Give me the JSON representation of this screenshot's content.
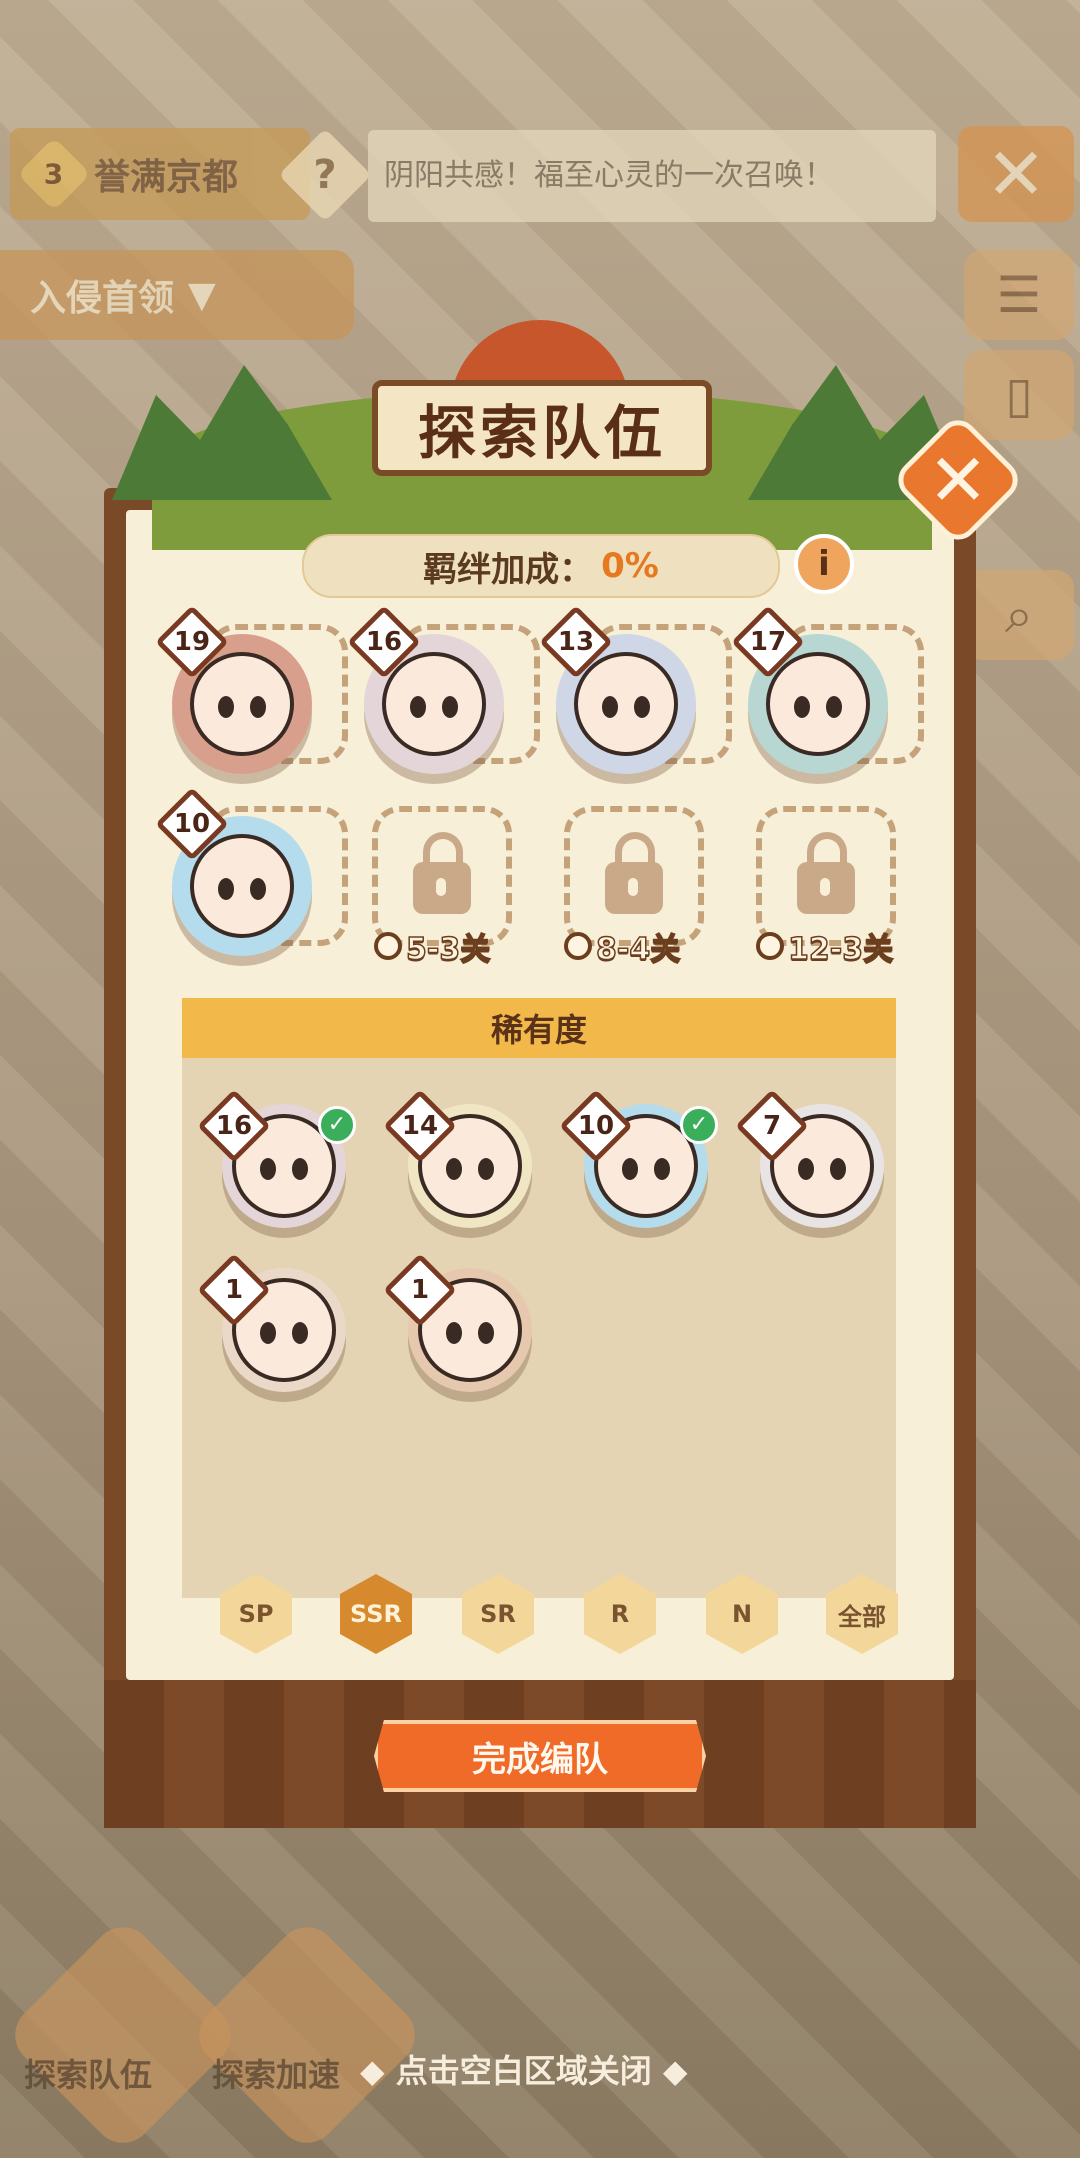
{
  "topbar": {
    "stage_number": "3",
    "stage_name": "誉满京都",
    "help_symbol": "?",
    "marquee": "阴阳共感！福至心灵的一次召唤！",
    "close_symbol": "✕",
    "boss_dropdown": "入侵首领"
  },
  "modal": {
    "title": "探索队伍",
    "close_symbol": "✕",
    "bond_label": "羁绊加成：",
    "bond_value": "0%",
    "info_symbol": "i",
    "team_slots": [
      {
        "level": "19",
        "color": "#d8a08c"
      },
      {
        "level": "16",
        "color": "#e4d5d8"
      },
      {
        "level": "13",
        "color": "#cfd7e6"
      },
      {
        "level": "17",
        "color": "#b8d6d2"
      },
      {
        "level": "10",
        "color": "#b5dcec"
      }
    ],
    "locked_slots": [
      {
        "requirement": "5-3关"
      },
      {
        "requirement": "8-4关"
      },
      {
        "requirement": "12-3关"
      }
    ],
    "rarity_header": "稀有度",
    "roster": [
      {
        "level": "16",
        "selected": true,
        "color": "#e4d5d8"
      },
      {
        "level": "14",
        "selected": false,
        "color": "#f0e6c4"
      },
      {
        "level": "10",
        "selected": true,
        "color": "#b5dcec"
      },
      {
        "level": "7",
        "selected": false,
        "color": "#e8e4e4"
      },
      {
        "level": "1",
        "selected": false,
        "color": "#ead9c8"
      },
      {
        "level": "1",
        "selected": false,
        "color": "#e6c8ae"
      }
    ],
    "filters": [
      "SP",
      "SSR",
      "SR",
      "R",
      "N",
      "全部"
    ],
    "active_filter": "SSR",
    "confirm_label": "完成编队"
  },
  "bottom": {
    "explore_team_label": "探索队伍",
    "explore_speed_label": "探索加速",
    "close_hint": "◆ 点击空白区域关闭 ◆"
  }
}
